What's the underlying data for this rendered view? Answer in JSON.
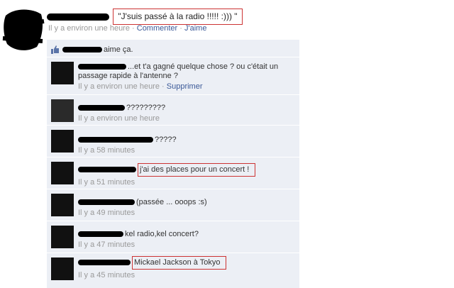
{
  "post": {
    "status": "\"J'suis passé à la radio !!!!! :))) \"",
    "time": "Il y a environ une heure",
    "sep1": " · ",
    "comment_link": "Commenter",
    "sep2": " · ",
    "like_link": "J'aime"
  },
  "likes": {
    "text": "aime ça."
  },
  "comments": [
    {
      "text": "...et t'a gagné quelque chose ? ou c'était un passage rapide à l'antenne ?",
      "time": "Il y a environ une heure",
      "sep": " · ",
      "action": "Supprimer"
    },
    {
      "text": "?????????",
      "time": "Il y a environ une heure"
    },
    {
      "text": "?????",
      "time": "Il y a 58 minutes"
    },
    {
      "text": "j'ai des places pour un concert !",
      "time": "Il y a 51 minutes"
    },
    {
      "text": "(passée ... ooops :s)",
      "time": "Il y a 49 minutes"
    },
    {
      "text": "kel radio,kel concert?",
      "time": "Il y a 47 minutes"
    },
    {
      "text": "Mickael Jackson à Tokyo",
      "time": "Il y a 45 minutes"
    }
  ],
  "colors": {
    "link": "#3b5998",
    "highlight": "#cc3333",
    "thread_bg": "#eceff5",
    "meta": "#999999"
  }
}
